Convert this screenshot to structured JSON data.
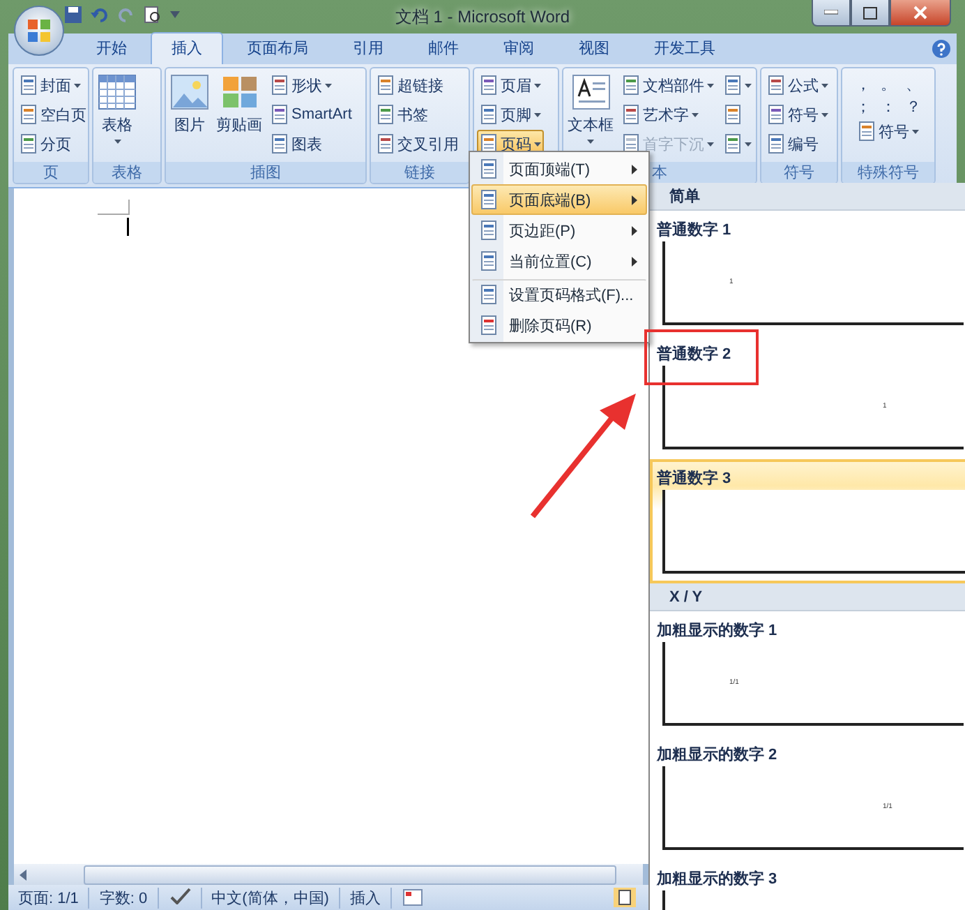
{
  "window": {
    "title": "文档 1 - Microsoft Word"
  },
  "tabs": [
    {
      "label": "开始",
      "selected": false
    },
    {
      "label": "插入",
      "selected": true
    },
    {
      "label": "页面布局",
      "selected": false
    },
    {
      "label": "引用",
      "selected": false
    },
    {
      "label": "邮件",
      "selected": false
    },
    {
      "label": "审阅",
      "selected": false
    },
    {
      "label": "视图",
      "selected": false
    },
    {
      "label": "开发工具",
      "selected": false
    }
  ],
  "ribbon": {
    "groups": [
      {
        "label": "页",
        "columns": [
          [
            {
              "label": "封面",
              "kind": "small",
              "dropdown": true
            },
            {
              "label": "空白页",
              "kind": "small",
              "dropdown": false
            },
            {
              "label": "分页",
              "kind": "small",
              "dropdown": false
            }
          ]
        ]
      },
      {
        "label": "表格",
        "columns": [
          [
            {
              "label": "表格",
              "kind": "large",
              "dropdown": true
            }
          ]
        ]
      },
      {
        "label": "插图",
        "columns": [
          [
            {
              "label": "图片",
              "kind": "large",
              "dropdown": false
            }
          ],
          [
            {
              "label": "剪贴画",
              "kind": "large",
              "dropdown": false
            }
          ],
          [
            {
              "label": "形状",
              "kind": "small",
              "dropdown": true
            },
            {
              "label": "SmartArt",
              "kind": "small",
              "dropdown": false
            },
            {
              "label": "图表",
              "kind": "small",
              "dropdown": false
            }
          ]
        ]
      },
      {
        "label": "链接",
        "columns": [
          [
            {
              "label": "超链接",
              "kind": "small",
              "dropdown": false
            },
            {
              "label": "书签",
              "kind": "small",
              "dropdown": false
            },
            {
              "label": "交叉引用",
              "kind": "small",
              "dropdown": false
            }
          ]
        ]
      },
      {
        "columns": [
          [
            {
              "label": "页眉",
              "kind": "small",
              "dropdown": true,
              "active": false
            },
            {
              "label": "页脚",
              "kind": "small",
              "dropdown": true,
              "active": false
            },
            {
              "label": "页码",
              "kind": "small",
              "dropdown": true,
              "active": true
            }
          ]
        ]
      },
      {
        "label": "本",
        "columns": [
          [
            {
              "label": "文本框",
              "kind": "large",
              "dropdown": true
            }
          ],
          [
            {
              "label": "文档部件",
              "kind": "small",
              "dropdown": true,
              "disabled": false
            },
            {
              "label": "艺术字",
              "kind": "small",
              "dropdown": true,
              "disabled": false
            },
            {
              "label": "首字下沉",
              "kind": "small",
              "dropdown": true,
              "disabled": true
            }
          ],
          [
            {
              "kind": "small",
              "dropdown": true
            },
            {
              "kind": "small",
              "dropdown": false
            },
            {
              "kind": "small",
              "dropdown": true
            }
          ]
        ]
      },
      {
        "label": "符号",
        "columns": [
          [
            {
              "label": "公式",
              "kind": "small",
              "dropdown": true
            },
            {
              "label": "符号",
              "kind": "small",
              "dropdown": true
            },
            {
              "label": "编号",
              "kind": "small",
              "dropdown": false
            }
          ]
        ]
      },
      {
        "label": "特殊符号",
        "punctuation": [
          "，",
          "。",
          "、",
          "；",
          "：",
          "？"
        ],
        "columns": [
          [
            {
              "label": "符号",
              "kind": "small",
              "dropdown": true
            }
          ]
        ]
      }
    ]
  },
  "menu": {
    "items": [
      {
        "label": "页面顶端(T)",
        "submenu": true,
        "selected": false
      },
      {
        "label": "页面底端(B)",
        "submenu": true,
        "selected": true
      },
      {
        "label": "页边距(P)",
        "submenu": true,
        "selected": false
      },
      {
        "label": "当前位置(C)",
        "submenu": true,
        "selected": false
      },
      {
        "label": "设置页码格式(F)...",
        "submenu": false,
        "selected": false
      },
      {
        "label": "删除页码(R)",
        "submenu": false,
        "selected": false
      }
    ]
  },
  "gallery": {
    "sections": [
      {
        "heading": "简单",
        "items": [
          {
            "label": "普通数字 1",
            "number": "1",
            "kind": "left",
            "hovered": false
          },
          {
            "label": "普通数字 2",
            "number": "1",
            "kind": "center",
            "hovered": false
          },
          {
            "label": "普通数字 3",
            "hovered": true
          }
        ]
      },
      {
        "heading": "X / Y",
        "items": [
          {
            "label": "加粗显示的数字 1",
            "number": "1/1",
            "kind": "left",
            "hovered": false
          },
          {
            "label": "加粗显示的数字 2",
            "number": "1/1",
            "kind": "center",
            "hovered": false
          },
          {
            "label": "加粗显示的数字 3",
            "hovered": false
          }
        ]
      }
    ]
  },
  "status_bar": {
    "items": [
      "页面: 1/1",
      "字数: 0",
      "中文(简体，中国)",
      "插入"
    ]
  }
}
